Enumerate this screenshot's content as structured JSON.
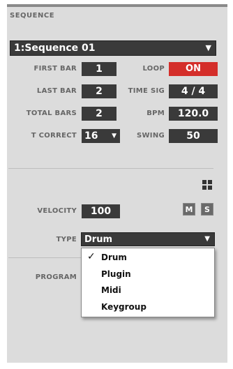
{
  "section_title": "SEQUENCE",
  "sequence": {
    "value": "1:Sequence 01",
    "arrow": "▼"
  },
  "fields": {
    "first_bar": {
      "label": "FIRST BAR",
      "value": "1"
    },
    "last_bar": {
      "label": "LAST BAR",
      "value": "2"
    },
    "total_bars": {
      "label": "TOTAL BARS",
      "value": "2"
    },
    "t_correct": {
      "label": "T CORRECT",
      "value": "16",
      "arrow": "▼"
    },
    "loop": {
      "label": "LOOP",
      "value": "ON"
    },
    "time_sig": {
      "label": "TIME SIG",
      "value": "4 / 4"
    },
    "bpm": {
      "label": "BPM",
      "value": "120.0"
    },
    "swing": {
      "label": "SWING",
      "value": "50"
    }
  },
  "velocity": {
    "label": "VELOCITY",
    "value": "100"
  },
  "buttons": {
    "mute": "M",
    "solo": "S"
  },
  "type": {
    "label": "TYPE",
    "value": "Drum",
    "arrow": "▼",
    "options": [
      "Drum",
      "Plugin",
      "Midi",
      "Keygroup"
    ],
    "check": "✓"
  },
  "program": {
    "label": "PROGRAM"
  },
  "colors": {
    "accent": "#d42e2a",
    "field_bg": "#3a3a3a",
    "panel_bg": "#dcdcdc"
  },
  "icons": {
    "grid": "grid-icon"
  }
}
